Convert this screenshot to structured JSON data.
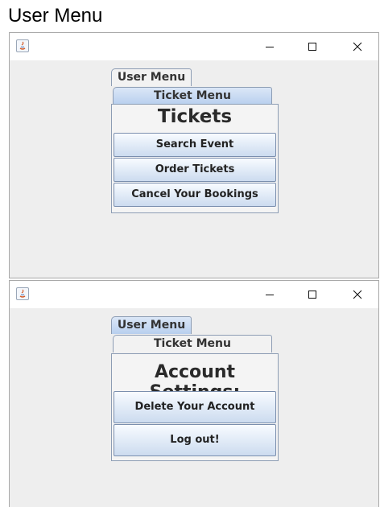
{
  "caption": "User Menu",
  "icons": {
    "app": "java-icon",
    "minimize": "minimize-icon",
    "maximize": "maximize-icon",
    "close": "close-icon"
  },
  "windows": [
    {
      "tabs": {
        "user_menu": "User Menu",
        "ticket_menu": "Ticket Menu",
        "selected": "Ticket Menu"
      },
      "panel_title": "Tickets",
      "buttons": [
        "Search Event",
        "Order Tickets",
        "Cancel Your Bookings"
      ]
    },
    {
      "tabs": {
        "user_menu": "User Menu",
        "ticket_menu": "Ticket Menu",
        "selected": "User Menu"
      },
      "panel_title": "Account Settings:",
      "buttons": [
        "Delete Your Account",
        "Log out!"
      ]
    }
  ],
  "colors": {
    "window_bg": "#eeeeee",
    "tab_selected": "#c8d9f2",
    "button_gradient_bottom": "#ccdbef"
  }
}
